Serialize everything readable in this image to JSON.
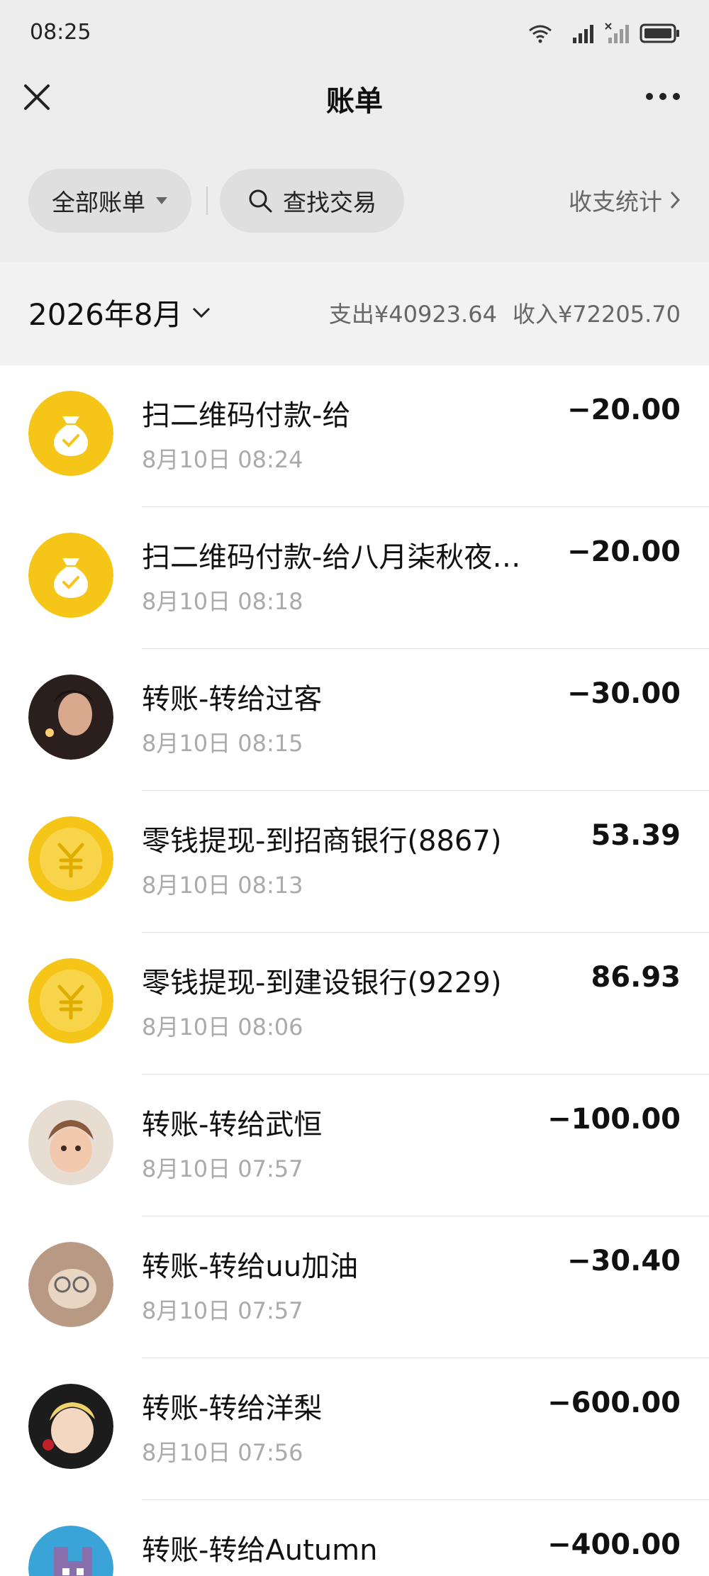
{
  "status": {
    "time": "08:25",
    "network": "5G"
  },
  "nav": {
    "title": "账单"
  },
  "filters": {
    "all_label": "全部账单",
    "search_label": "查找交易",
    "stats_label": "收支统计"
  },
  "month": {
    "label": "2026年8月",
    "expense": "支出¥40923.64",
    "income": "收入¥72205.70"
  },
  "transactions": [
    {
      "title": "扫二维码付款-给",
      "time": "8月10日 08:24",
      "amount": "−20.00",
      "icon": "money-bag-icon"
    },
    {
      "title": "扫二维码付款-给八月柒秋夜…",
      "time": "8月10日 08:18",
      "amount": "−20.00",
      "icon": "money-bag-icon"
    },
    {
      "title": "转账-转给过客",
      "time": "8月10日 08:15",
      "amount": "−30.00",
      "icon": "avatar"
    },
    {
      "title": "零钱提现-到招商银行(8867)",
      "time": "8月10日 08:13",
      "amount": "53.39",
      "icon": "yuan-coin-icon"
    },
    {
      "title": "零钱提现-到建设银行(9229)",
      "time": "8月10日 08:06",
      "amount": "86.93",
      "icon": "yuan-coin-icon"
    },
    {
      "title": "转账-转给武恒",
      "time": "8月10日 07:57",
      "amount": "−100.00",
      "icon": "avatar"
    },
    {
      "title": "转账-转给uu加油",
      "time": "8月10日 07:57",
      "amount": "−30.40",
      "icon": "avatar"
    },
    {
      "title": "转账-转给洋梨",
      "time": "8月10日 07:56",
      "amount": "−600.00",
      "icon": "avatar"
    },
    {
      "title": "转账-转给Autumn",
      "time": "",
      "amount": "−400.00",
      "icon": "avatar"
    }
  ],
  "colors": {
    "accent_yellow": "#f5c518",
    "background": "#ededed"
  }
}
